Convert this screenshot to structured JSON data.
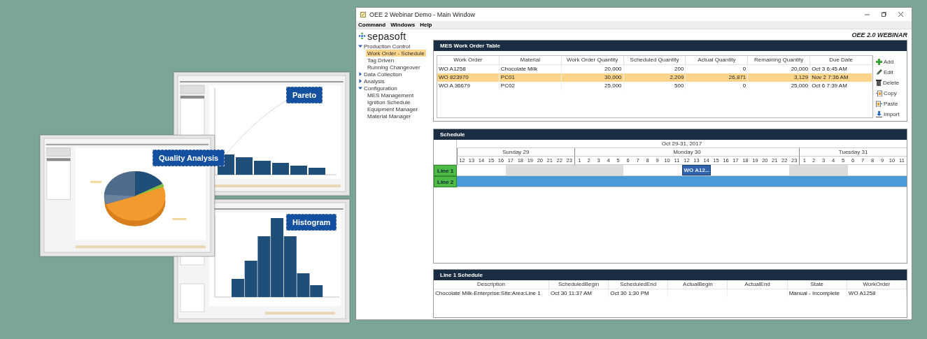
{
  "window": {
    "title": "OEE 2 Webinar Demo - Main Window",
    "menu": [
      "Command",
      "Windows",
      "Help"
    ],
    "brand": "sepasoft",
    "banner": "OEE 2.0 WEBINAR"
  },
  "nav": [
    {
      "label": "Production Control",
      "expanded": true,
      "children": [
        {
          "label": "Work Order - Schedule",
          "selected": true
        },
        {
          "label": "Tag Driven",
          "selected": false
        },
        {
          "label": "Running Changeover",
          "selected": false
        }
      ]
    },
    {
      "label": "Data Collection",
      "expanded": false
    },
    {
      "label": "Analysis",
      "expanded": false
    },
    {
      "label": "Configuration",
      "expanded": true,
      "children": [
        {
          "label": "MES Management",
          "selected": false
        },
        {
          "label": "Ignition Schedule",
          "selected": false
        },
        {
          "label": "Equipment Manager",
          "selected": false
        },
        {
          "label": "Material Manager",
          "selected": false
        }
      ]
    }
  ],
  "work_orders": {
    "title": "MES Work Order Table",
    "columns": [
      {
        "label": "Work Order",
        "numeric": false
      },
      {
        "label": "Material",
        "numeric": false
      },
      {
        "label": "Work Order Quantity",
        "numeric": true
      },
      {
        "label": "Scheduled Quantity",
        "numeric": true
      },
      {
        "label": "Actual Quantity",
        "numeric": true
      },
      {
        "label": "Remaining Quantity",
        "numeric": true
      },
      {
        "label": "Due Date",
        "numeric": false
      }
    ],
    "rows": [
      {
        "selected": false,
        "cells": [
          "WO A1258",
          "Chocolate Milk",
          "20,000",
          "200",
          "0",
          "20,000",
          "Oct 3 6:45 AM"
        ]
      },
      {
        "selected": true,
        "cells": [
          "WO 823970",
          "PC01",
          "30,000",
          "2,209",
          "26,871",
          "3,129",
          "Nov 2 7:36 AM"
        ]
      },
      {
        "selected": false,
        "cells": [
          "WO A 36679",
          "PC02",
          "25,000",
          "500",
          "0",
          "25,000",
          "Oct 6 7:39 AM"
        ]
      }
    ]
  },
  "actions": [
    {
      "kind": "add",
      "label": "Add"
    },
    {
      "kind": "edit",
      "label": "Edit"
    },
    {
      "kind": "delete",
      "label": "Delete"
    },
    {
      "kind": "copy",
      "label": "Copy"
    },
    {
      "kind": "paste",
      "label": "Paste"
    },
    {
      "kind": "import",
      "label": "Import"
    }
  ],
  "schedule": {
    "title": "Schedule",
    "range": "Oct 29-31, 2017",
    "days": [
      {
        "label": "Sunday 29",
        "hours": [
          "12",
          "13",
          "14",
          "15",
          "16",
          "17",
          "18",
          "19",
          "20",
          "21",
          "22",
          "23"
        ]
      },
      {
        "label": "Monday 30",
        "hours": [
          "1",
          "2",
          "3",
          "4",
          "5",
          "6",
          "7",
          "8",
          "9",
          "10",
          "11",
          "12",
          "13",
          "14",
          "15",
          "16",
          "17",
          "18",
          "19",
          "20",
          "21",
          "22",
          "23"
        ]
      },
      {
        "label": "Tuesday 31",
        "hours": [
          "1",
          "2",
          "3",
          "4",
          "5",
          "6",
          "7",
          "8",
          "9",
          "10",
          "11"
        ]
      }
    ],
    "lines": [
      {
        "label": "Line 1",
        "order_label": "WO A12...",
        "slots": [
          {
            "kind": "idle"
          },
          {
            "kind": "idle"
          },
          {
            "kind": "idle"
          },
          {
            "kind": "idle"
          },
          {
            "kind": "idle"
          },
          {
            "kind": "downtime"
          },
          {
            "kind": "downtime"
          },
          {
            "kind": "downtime"
          },
          {
            "kind": "downtime"
          },
          {
            "kind": "downtime"
          },
          {
            "kind": "downtime"
          },
          {
            "kind": "downtime"
          },
          {
            "kind": "downtime"
          },
          {
            "kind": "downtime"
          },
          {
            "kind": "downtime"
          },
          {
            "kind": "downtime"
          },
          {
            "kind": "downtime"
          },
          {
            "kind": "idle"
          },
          {
            "kind": "idle"
          },
          {
            "kind": "idle"
          },
          {
            "kind": "idle"
          },
          {
            "kind": "idle"
          },
          {
            "kind": "idle"
          },
          {
            "kind": "order"
          },
          {
            "kind": "order"
          },
          {
            "kind": "order"
          },
          {
            "kind": "idle"
          },
          {
            "kind": "idle"
          },
          {
            "kind": "idle"
          },
          {
            "kind": "idle"
          },
          {
            "kind": "idle"
          },
          {
            "kind": "idle"
          },
          {
            "kind": "idle"
          },
          {
            "kind": "idle"
          },
          {
            "kind": "downtime"
          },
          {
            "kind": "downtime"
          },
          {
            "kind": "downtime"
          },
          {
            "kind": "downtime"
          },
          {
            "kind": "downtime"
          },
          {
            "kind": "downtime"
          },
          {
            "kind": "idle"
          },
          {
            "kind": "idle"
          },
          {
            "kind": "idle"
          },
          {
            "kind": "idle"
          },
          {
            "kind": "idle"
          },
          {
            "kind": "idle"
          }
        ]
      },
      {
        "label": "Line 2",
        "slots": [
          {
            "kind": "running"
          },
          {
            "kind": "running"
          },
          {
            "kind": "running"
          },
          {
            "kind": "running"
          },
          {
            "kind": "running"
          },
          {
            "kind": "running"
          },
          {
            "kind": "running"
          },
          {
            "kind": "running"
          },
          {
            "kind": "running"
          },
          {
            "kind": "running"
          },
          {
            "kind": "running"
          },
          {
            "kind": "running"
          },
          {
            "kind": "running"
          },
          {
            "kind": "running"
          },
          {
            "kind": "running"
          },
          {
            "kind": "running"
          },
          {
            "kind": "running"
          },
          {
            "kind": "running"
          },
          {
            "kind": "running"
          },
          {
            "kind": "running"
          },
          {
            "kind": "running"
          },
          {
            "kind": "running"
          },
          {
            "kind": "running"
          },
          {
            "kind": "running"
          },
          {
            "kind": "running"
          },
          {
            "kind": "running"
          },
          {
            "kind": "running"
          },
          {
            "kind": "running"
          },
          {
            "kind": "running"
          },
          {
            "kind": "running"
          },
          {
            "kind": "running"
          },
          {
            "kind": "running"
          },
          {
            "kind": "running"
          },
          {
            "kind": "running"
          },
          {
            "kind": "running"
          },
          {
            "kind": "running"
          },
          {
            "kind": "running"
          },
          {
            "kind": "running"
          },
          {
            "kind": "running"
          },
          {
            "kind": "running"
          },
          {
            "kind": "running"
          },
          {
            "kind": "running"
          },
          {
            "kind": "running"
          },
          {
            "kind": "running"
          },
          {
            "kind": "running"
          },
          {
            "kind": "running"
          }
        ]
      }
    ]
  },
  "line_schedule": {
    "title": "Line 1 Schedule",
    "columns": [
      "Description",
      "ScheduledBegin",
      "ScheduledEnd",
      "ActualBegin",
      "ActualEnd",
      "State",
      "WorkOrder"
    ],
    "rows": [
      [
        "Chocolate Milk-Enterprise:Site:Area:Line 1",
        "Oct 30 11:37 AM",
        "Oct 30 1:30 PM",
        null,
        null,
        "Manual - Incomplete",
        "WO A1258"
      ]
    ]
  },
  "thumbnails": [
    {
      "kind": "pareto",
      "label": "Pareto"
    },
    {
      "kind": "histogram",
      "label": "Histogram"
    },
    {
      "kind": "quality",
      "label": "Quality Analysis"
    }
  ]
}
